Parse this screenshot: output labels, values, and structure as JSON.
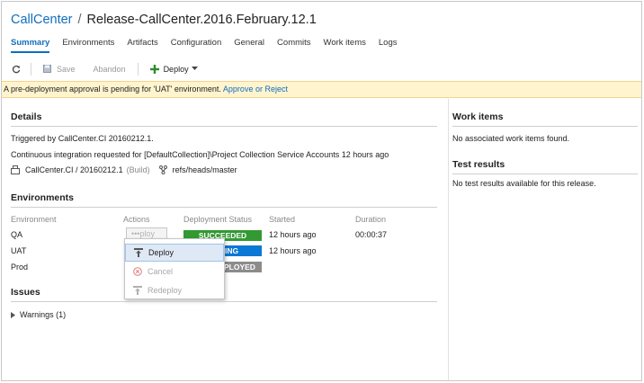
{
  "breadcrumb": {
    "project": "CallCenter",
    "separator": "/",
    "release": "Release-CallCenter.2016.February.12.1"
  },
  "tabs": [
    "Summary",
    "Environments",
    "Artifacts",
    "Configuration",
    "General",
    "Commits",
    "Work items",
    "Logs"
  ],
  "toolbar": {
    "save": "Save",
    "abandon": "Abandon",
    "deploy": "Deploy"
  },
  "banner": {
    "message": "A pre-deployment approval is pending for 'UAT' environment.",
    "link": "Approve or Reject"
  },
  "details": {
    "title": "Details",
    "triggered": "Triggered by CallCenter.CI 20160212.1.",
    "ci_message": "Continuous integration requested for [DefaultCollection]\\Project Collection Service Accounts 12 hours ago",
    "artifact": "CallCenter.CI / 20160212.1",
    "artifact_type": "(Build)",
    "branch": "refs/heads/master"
  },
  "environments": {
    "title": "Environments",
    "headers": {
      "environment": "Environment",
      "actions": "Actions",
      "status": "Deployment Status",
      "started": "Started",
      "duration": "Duration"
    },
    "rows": [
      {
        "name": "QA",
        "status": "SUCCEEDED",
        "status_color": "#339933",
        "started": "12 hours ago",
        "duration": "00:00:37"
      },
      {
        "name": "UAT",
        "status": "ING",
        "status_color": "#0a78d4",
        "started": "12 hours ago",
        "duration": ""
      },
      {
        "name": "Prod",
        "status": "PLOYED",
        "status_color": "#8c8c8c",
        "started": "",
        "duration": ""
      }
    ],
    "action_button": "•••ploy"
  },
  "action_menu": {
    "deploy": "Deploy",
    "cancel": "Cancel",
    "redeploy": "Redeploy"
  },
  "issues": {
    "title": "Issues",
    "warnings": "Warnings (1)"
  },
  "work_items": {
    "title": "Work items",
    "empty": "No associated work items found."
  },
  "test_results": {
    "title": "Test results",
    "empty": "No test results available for this release."
  },
  "colors": {
    "accent": "#106ebe",
    "banner_bg": "#fff4ce",
    "success": "#339933",
    "in_progress": "#0a78d4",
    "not_deployed": "#8c8c8c",
    "deploy_plus": "#2e8b2e"
  }
}
